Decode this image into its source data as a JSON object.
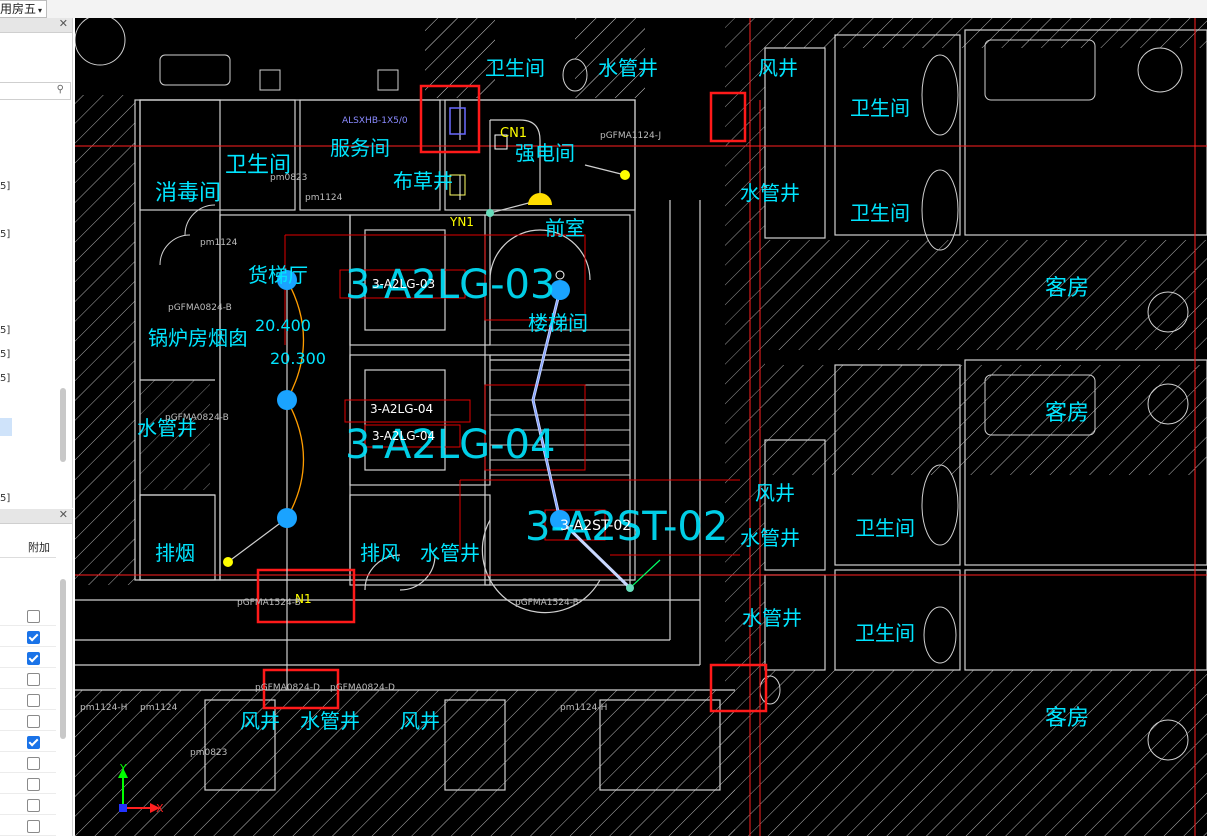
{
  "topbar": {
    "dropdown_label": "用房五",
    "dropdown_arrow": "▾"
  },
  "left_panel": {
    "close_glyph": "✕",
    "search_icon": "search-icon",
    "tree_items": [
      "5]",
      "5]",
      "5]",
      "5]",
      "5]",
      "5]"
    ],
    "properties": {
      "column_header": "附加",
      "checkboxes": [
        false,
        true,
        true,
        false,
        false,
        false,
        true,
        false,
        false,
        false,
        false
      ]
    }
  },
  "canvas": {
    "labels": {
      "hygiene": "卫生间",
      "disinfect": "消毒间",
      "service": "服务间",
      "linen": "布草井",
      "electric": "强电间",
      "front_hall": "前室",
      "freight": "货梯厅",
      "boiler": "锅炉房烟囱",
      "water_well": "水管井",
      "smoke": "排烟",
      "exhaust": "排风",
      "stair": "楼梯间",
      "wind_well": "风井",
      "guest_room": "客房"
    },
    "tags": {
      "als": "ALSXHB-1X5/0",
      "cn1": "CN1",
      "pgfm1": "pGFMA1124-J",
      "yn1": "YN1",
      "pm1124": "pm1124",
      "pgfma0824": "pGFMA0824-B",
      "pgfma1524": "pGFMA1524-B",
      "pm0823": "pm0823",
      "pm1124h": "pm1124-H",
      "pgfma0824d": "pGFMA0824-D",
      "n1": "N1",
      "a2lg03": "3-A2LG-03",
      "a2lg03small": "3-A2LG-03",
      "a2lg04": "3-A2LG-04",
      "a2lg04small": "3-A2LG-04",
      "a2lg04tag": "3-A2LG-04",
      "a2st02": "3-A2ST-02",
      "a2st02small": "3-A2ST-02",
      "elev1": "20.400",
      "elev2": "20.300",
      "axis_x": "X",
      "axis_y": "Y"
    }
  },
  "colors": {
    "cad_bg": "#000000",
    "cyan": "#00ffff",
    "red": "#ff0000",
    "selection_blue": "#1aa3ff",
    "yellow": "#ffff00",
    "highlight_red": "#ff1a1a"
  }
}
